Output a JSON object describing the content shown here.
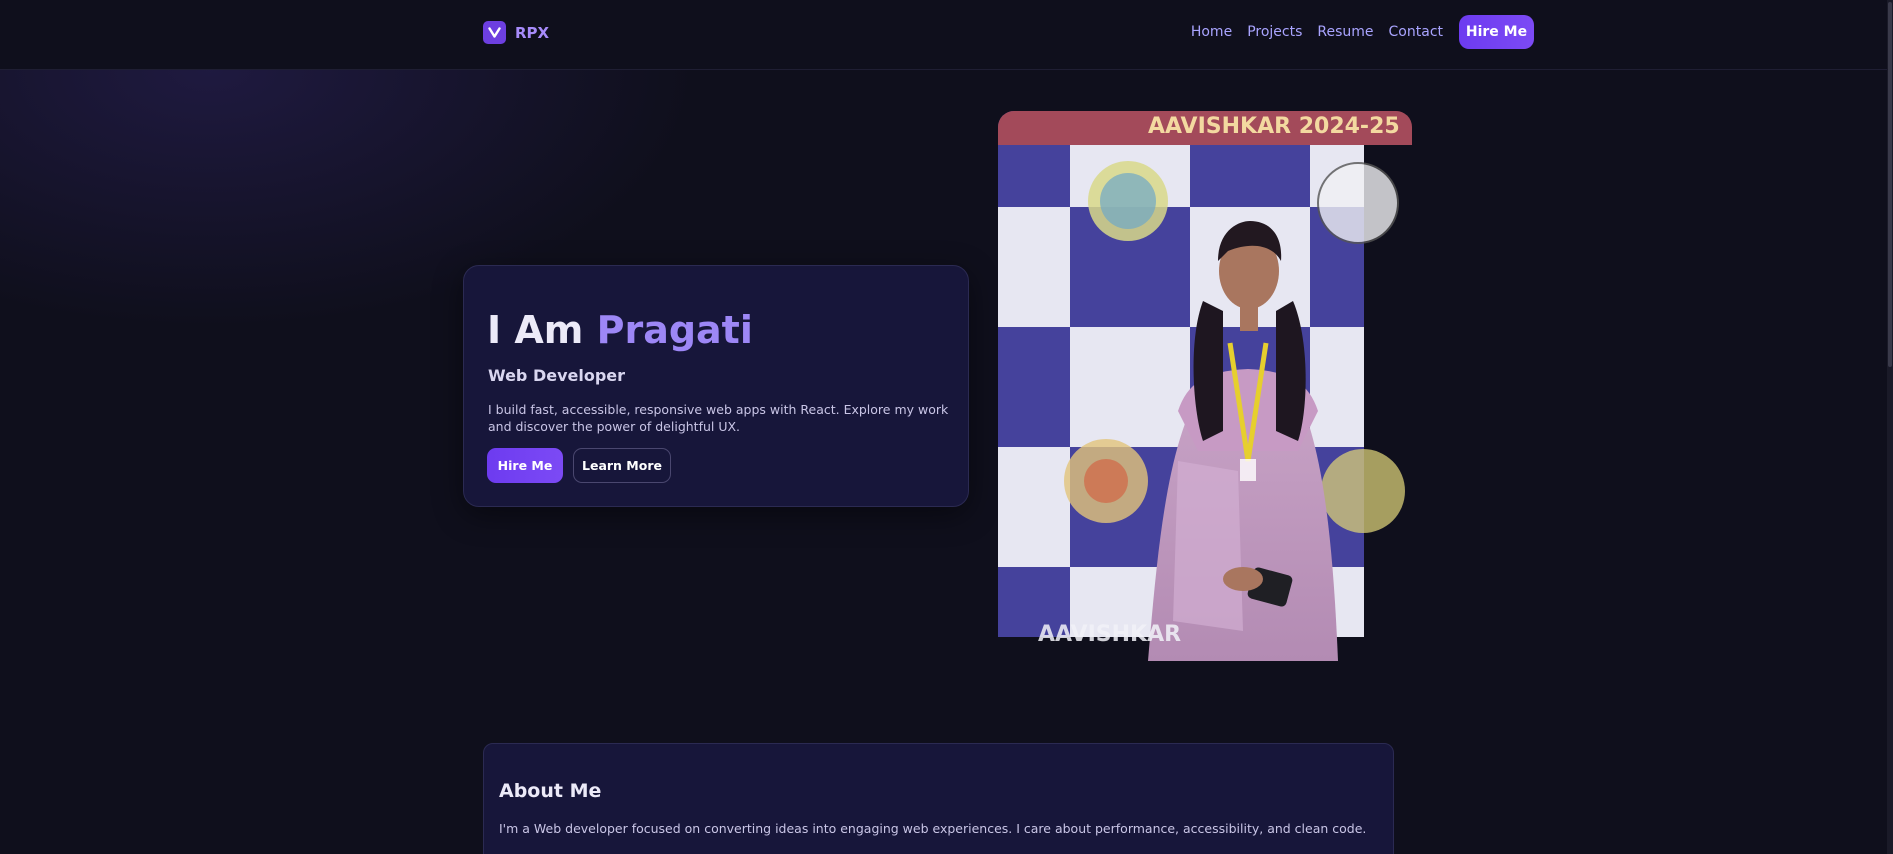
{
  "header": {
    "brand": "RPX",
    "nav": [
      {
        "label": "Home"
      },
      {
        "label": "Projects"
      },
      {
        "label": "Resume"
      },
      {
        "label": "Contact"
      }
    ],
    "cta_label": "Hire Me"
  },
  "hero": {
    "title_prefix": "I Am",
    "title_name": "Pragati",
    "subtitle": "Web Developer",
    "description": "I build fast, accessible, responsive web apps with React. Explore my work and discover the power of delightful UX.",
    "primary_label": "Hire Me",
    "secondary_label": "Learn More",
    "photo_banner_text": "AAVISHKAR 2024-25"
  },
  "about": {
    "title": "About Me",
    "text": "I'm a Web developer focused on converting ideas into engaging web experiences. I care about performance, accessibility, and clean code."
  },
  "colors": {
    "background": "#0f0f1c",
    "card": "#17163a",
    "accent": "#9d87f6",
    "primary": "#6d3bf0",
    "nav_link": "#a9a4ff"
  },
  "icons": {
    "logo": "v-logo-icon"
  }
}
